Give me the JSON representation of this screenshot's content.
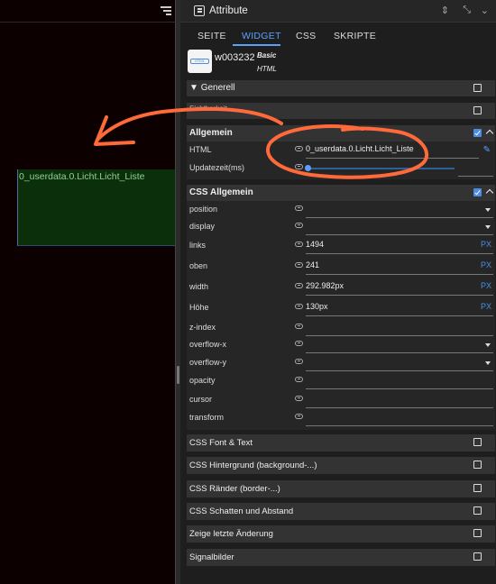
{
  "canvas": {
    "widget_text": "0_userdata.0.Licht.Licht_Liste"
  },
  "panel": {
    "title": "Attribute",
    "tabs": [
      "SEITE",
      "WIDGET",
      "CSS",
      "SKRIPTE"
    ],
    "active_tab": "WIDGET"
  },
  "widget": {
    "id": "w003232",
    "set": "Basic",
    "type": "HTML",
    "thumb_label": "HTML"
  },
  "groups": {
    "generell": "Generell",
    "sichtbarkeit_partial": "Sichtbarkeit",
    "allgemein": {
      "title": "Allgemein",
      "rows": [
        {
          "label": "HTML",
          "value": "0_userdata.0.Licht.Licht_Liste"
        },
        {
          "label": "Updatezeit(ms)",
          "value": ""
        }
      ],
      "update_slider_value": 0
    },
    "css_allgemein": {
      "title": "CSS Allgemein",
      "rows": [
        {
          "label": "position",
          "value": "",
          "unit": ""
        },
        {
          "label": "display",
          "value": "",
          "unit": ""
        },
        {
          "label": "links",
          "value": "1494",
          "unit": "PX"
        },
        {
          "label": "oben",
          "value": "241",
          "unit": "PX"
        },
        {
          "label": "width",
          "value": "292.982px",
          "unit": "PX"
        },
        {
          "label": "Höhe",
          "value": "130px",
          "unit": "PX"
        },
        {
          "label": "z-index",
          "value": "",
          "unit": ""
        },
        {
          "label": "overflow-x",
          "value": "",
          "unit": ""
        },
        {
          "label": "overflow-y",
          "value": "",
          "unit": ""
        },
        {
          "label": "opacity",
          "value": "",
          "unit": ""
        },
        {
          "label": "cursor",
          "value": "",
          "unit": ""
        },
        {
          "label": "transform",
          "value": "",
          "unit": ""
        }
      ]
    },
    "sections": [
      "CSS Font & Text",
      "CSS Hintergrund (background-...)",
      "CSS Ränder (border-...)",
      "CSS Schatten und Abstand",
      "Zeige letzte Änderung",
      "Signalbilder"
    ]
  },
  "colors": {
    "accent": "#5aa0ff",
    "annotation": "#ff6a3a",
    "widget_bg": "#0b2e0b"
  }
}
